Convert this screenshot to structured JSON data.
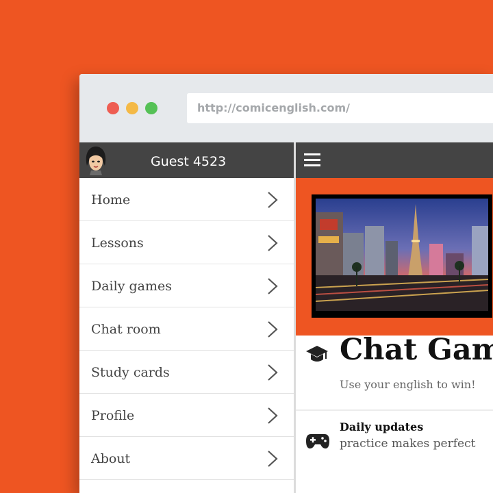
{
  "browser": {
    "url": "http://comicenglish.com/"
  },
  "sidebar": {
    "user_name": "Guest 4523",
    "items": [
      {
        "label": "Home"
      },
      {
        "label": "Lessons"
      },
      {
        "label": "Daily games"
      },
      {
        "label": "Chat room"
      },
      {
        "label": "Study cards"
      },
      {
        "label": "Profile"
      },
      {
        "label": "About"
      }
    ]
  },
  "main": {
    "title": "Chat Game",
    "subtitle": "Use your english to win!",
    "feature": {
      "title": "Daily updates",
      "subtitle": "practice makes perfect"
    }
  },
  "colors": {
    "brand_orange": "#ee5522",
    "header_dark": "#444444",
    "traffic_red": "#ee5d52",
    "traffic_yellow": "#f4b946",
    "traffic_green": "#55c156"
  },
  "icons": [
    "menu-icon",
    "chevron-right-icon",
    "graduation-cap-icon",
    "gamepad-icon"
  ]
}
